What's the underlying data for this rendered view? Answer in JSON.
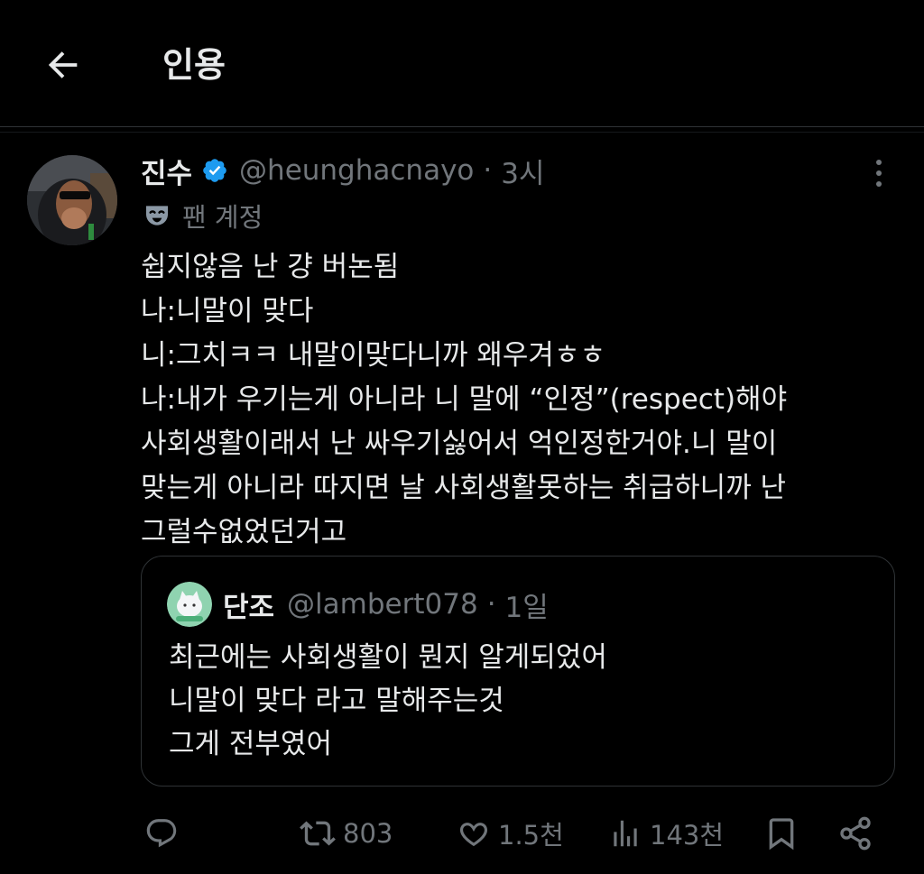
{
  "header": {
    "title": "인용"
  },
  "tweet": {
    "author_name": "진수",
    "handle": "@heunghacnayo",
    "separator": "·",
    "time": "3시",
    "fan_label": "팬 계정",
    "body": "쉽지않음 난 걍 버논됨\n나:니말이 맞다\n니:그치ㅋㅋ 내말이맞다니까 왜우겨ㅎㅎ\n나:내가 우기는게 아니라 니 말에 “인정”(respect)해야\n사회생활이래서 난 싸우기싫어서 억인정한거야.니 말이\n맞는게 아니라 따지면 날 사회생활못하는 취급하니까 난\n그럴수없었던거고"
  },
  "quote": {
    "author_name": "단조",
    "handle": "@lambert078",
    "separator": "·",
    "time": "1일",
    "body": "최근에는 사회생활이 뭔지 알게되었어\n니말이 맞다 라고 말해주는것\n그게 전부였어"
  },
  "actions": {
    "reply_icon": "reply-icon",
    "retweet_icon": "retweet-icon",
    "retweet_count": "803",
    "like_icon": "heart-icon",
    "like_count": "1.5천",
    "views_icon": "analytics-icon",
    "views_count": "143천",
    "bookmark_icon": "bookmark-icon",
    "share_icon": "share-icon"
  },
  "colors": {
    "background": "#000000",
    "text": "#e7e9ea",
    "muted": "#71767b",
    "border": "#2f3336",
    "verified": "#1d9bf0"
  }
}
